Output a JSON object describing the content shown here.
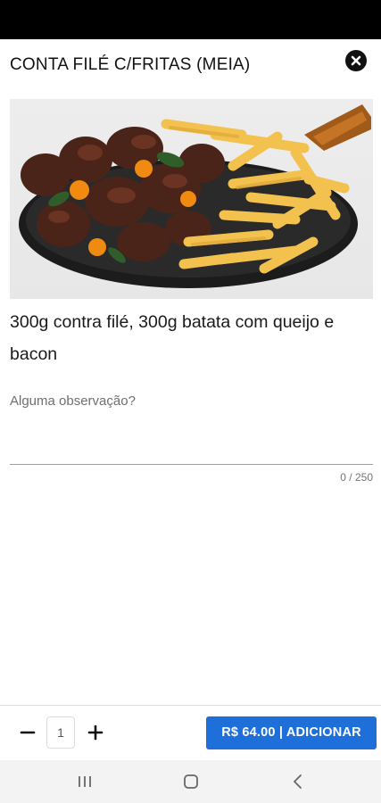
{
  "product": {
    "title": "CONTA FILÉ C/FRITAS (MEIA)",
    "description": "300g contra filé, 300g batata com queijo e bacon",
    "image_alt": "steak-with-fries-photo"
  },
  "notes": {
    "placeholder": "Alguma observação?",
    "value": "",
    "counter": "0 / 250"
  },
  "footer": {
    "quantity": "1",
    "add_button_label": "R$ 64.00 | ADICIONAR"
  },
  "icons": {
    "close": "close-icon",
    "minus": "minus-icon",
    "plus": "plus-icon",
    "nav_recents": "recent-apps-icon",
    "nav_home": "home-icon",
    "nav_back": "back-icon"
  },
  "colors": {
    "accent": "#1e6fd9",
    "status_bar": "#000000"
  }
}
